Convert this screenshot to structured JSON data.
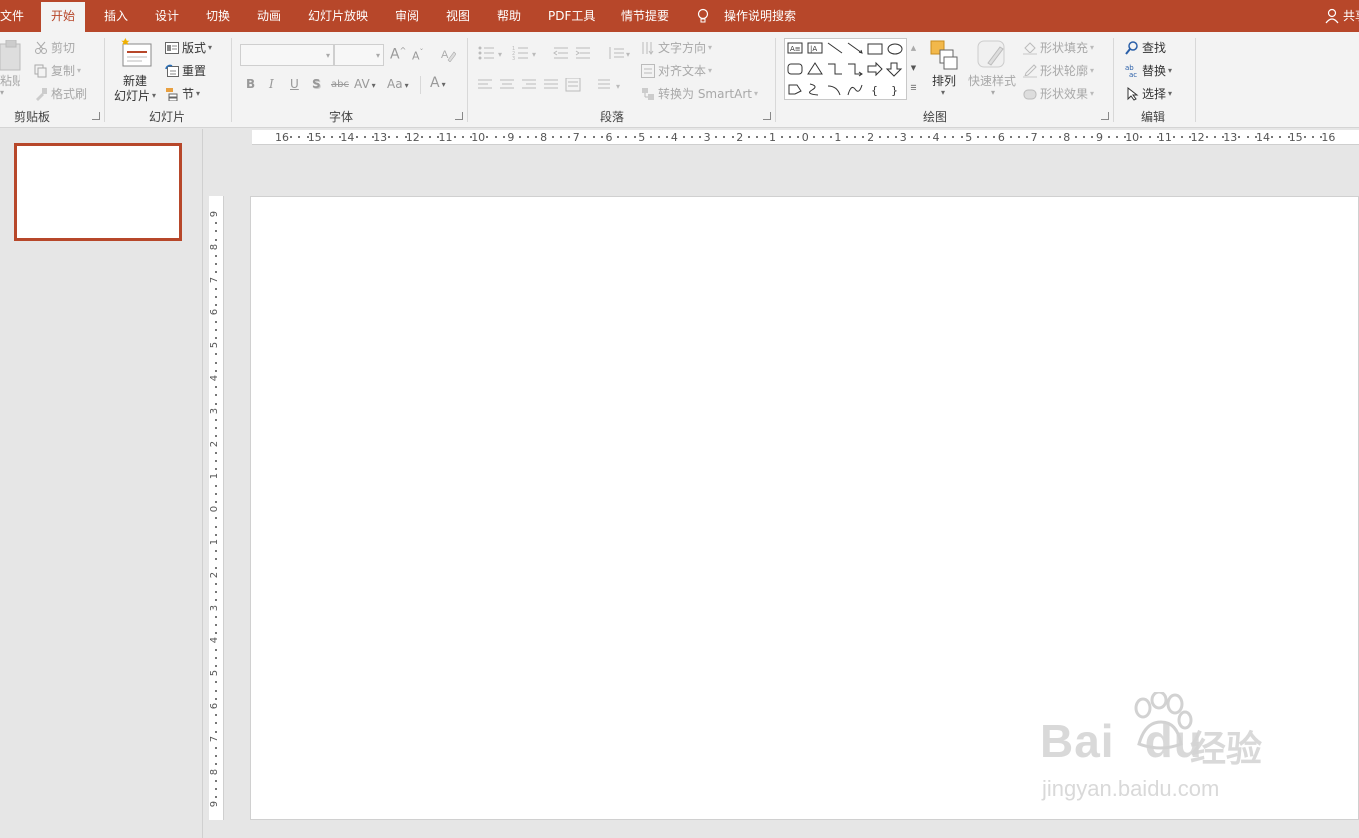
{
  "tabs": [
    {
      "label": "文件"
    },
    {
      "label": "开始"
    },
    {
      "label": "插入"
    },
    {
      "label": "设计"
    },
    {
      "label": "切换"
    },
    {
      "label": "动画"
    },
    {
      "label": "幻灯片放映"
    },
    {
      "label": "审阅"
    },
    {
      "label": "视图"
    },
    {
      "label": "帮助"
    },
    {
      "label": "PDF工具"
    },
    {
      "label": "情节提要"
    }
  ],
  "active_tab": "开始",
  "tell_me": "操作说明搜索",
  "share": "共享",
  "clipboard": {
    "paste": "粘贴",
    "cut": "剪切",
    "copy": "复制",
    "format_painter": "格式刷",
    "label": "剪贴板"
  },
  "slides_group": {
    "new_slide_line1": "新建",
    "new_slide_line2": "幻灯片",
    "layout": "版式",
    "reset": "重置",
    "section": "节",
    "label": "幻灯片"
  },
  "font_group": {
    "bold": "B",
    "italic": "I",
    "underline": "U",
    "shadow": "S",
    "strike": "abc",
    "spacing": "AV",
    "case": "Aa",
    "color": "A",
    "grow": "A",
    "shrink": "A",
    "label": "字体"
  },
  "paragraph_group": {
    "text_direction": "文字方向",
    "align_text": "对齐文本",
    "smartart": "转换为 SmartArt",
    "label": "段落"
  },
  "drawing_group": {
    "arrange": "排列",
    "quick_styles": "快速样式",
    "shape_fill": "形状填充",
    "shape_outline": "形状轮廓",
    "shape_effects": "形状效果",
    "label": "绘图"
  },
  "editing_group": {
    "find": "查找",
    "replace": "替换",
    "select": "选择",
    "label": "编辑"
  },
  "hruler_labels": [
    "16",
    "15",
    "14",
    "13",
    "12",
    "11",
    "10",
    "9",
    "8",
    "7",
    "6",
    "5",
    "4",
    "3",
    "2",
    "1",
    "0",
    "1",
    "2",
    "3",
    "4",
    "5",
    "6",
    "7",
    "8",
    "9",
    "10",
    "11",
    "12",
    "13",
    "14",
    "15",
    "16"
  ],
  "vruler_labels": [
    "9",
    "8",
    "7",
    "6",
    "5",
    "4",
    "3",
    "2",
    "1",
    "0",
    "1",
    "2",
    "3",
    "4",
    "5",
    "6",
    "7",
    "8",
    "9"
  ],
  "watermark": {
    "brand": "Bai",
    "brand2": "du",
    "cn": "经验",
    "url": "jingyan.baidu.com"
  },
  "colors": {
    "accent": "#b7472a",
    "ribbon": "#f3f3f3",
    "canvas": "#e6e6e6"
  }
}
